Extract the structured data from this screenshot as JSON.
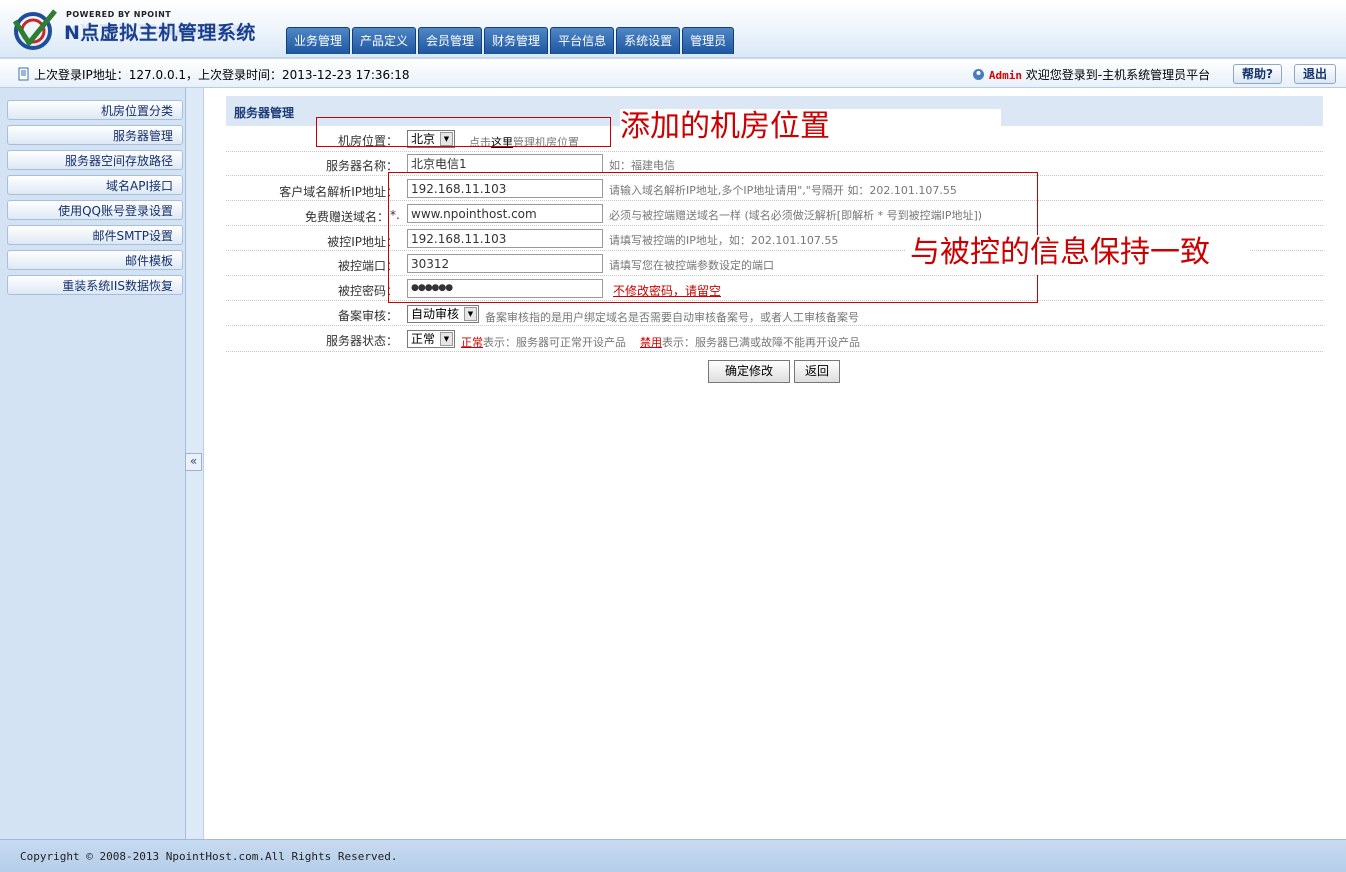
{
  "logo": {
    "powered": "POWERED BY NPOINT",
    "title": "N点虚拟主机管理系统"
  },
  "nav": [
    "业务管理",
    "产品定义",
    "会员管理",
    "财务管理",
    "平台信息",
    "系统设置",
    "管理员"
  ],
  "info": {
    "last_login": "上次登录IP地址：127.0.0.1，上次登录时间：2013-12-23 17:36:18",
    "admin": "Admin",
    "welcome": "欢迎您登录到-主机系统管理员平台",
    "help": "帮助?",
    "logout": "退出"
  },
  "sidebar": {
    "items": [
      "机房位置分类",
      "服务器管理",
      "服务器空间存放路径",
      "域名API接口",
      "使用QQ账号登录设置",
      "邮件SMTP设置",
      "邮件模板",
      "重装系统IIS数据恢复"
    ],
    "collapse": "«"
  },
  "panel": {
    "title": "服务器管理"
  },
  "form": {
    "location": {
      "label": "机房位置：",
      "value": "北京",
      "hint_pre": "点击",
      "hint_link": "这里",
      "hint_post": "管理机房位置"
    },
    "server_name": {
      "label": "服务器名称：",
      "value": "北京电信1",
      "hint": "如：福建电信"
    },
    "dns_ip": {
      "label": "客户域名解析IP地址：",
      "value": "192.168.11.103",
      "hint": "请输入域名解析IP地址,多个IP地址请用\",\"号隔开 如：202.101.107.55"
    },
    "free_domain": {
      "label": "免费赠送域名：",
      "prefix": "*.",
      "value": "www.npointhost.com",
      "hint": "必须与被控端赠送域名一样 (域名必须做泛解析[即解析 * 号到被控端IP地址])"
    },
    "ctrl_ip": {
      "label": "被控IP地址：",
      "value": "192.168.11.103",
      "hint": "请填写被控端的IP地址，如：202.101.107.55"
    },
    "ctrl_port": {
      "label": "被控端口：",
      "value": "30312",
      "hint": "请填写您在被控端参数设定的端口"
    },
    "ctrl_pwd": {
      "label": "被控密码：",
      "value": "●●●●●●",
      "hint": "不修改密码，请留空"
    },
    "audit": {
      "label": "备案审核：",
      "value": "自动审核",
      "hint": "备案审核指的是用户绑定域名是否需要自动审核备案号，或者人工审核备案号"
    },
    "status": {
      "label": "服务器状态：",
      "value": "正常",
      "normal": "正常",
      "normal_desc": "表示：服务器可正常开设产品",
      "disabled": "禁用",
      "disabled_desc": "表示：服务器已满或故障不能再开设产品"
    },
    "submit": "确定修改",
    "back": "返回"
  },
  "annotations": {
    "location_note": "添加的机房位置",
    "ctrl_note": "与被控的信息保持一致"
  },
  "footer": {
    "copyright": "Copyright © 2008-2013 NpointHost.com.All Rights Reserved."
  },
  "colors": {
    "accent": "#1d56a0",
    "annotation": "#cc0000",
    "sidebar_bg": "#d3e3f4"
  }
}
